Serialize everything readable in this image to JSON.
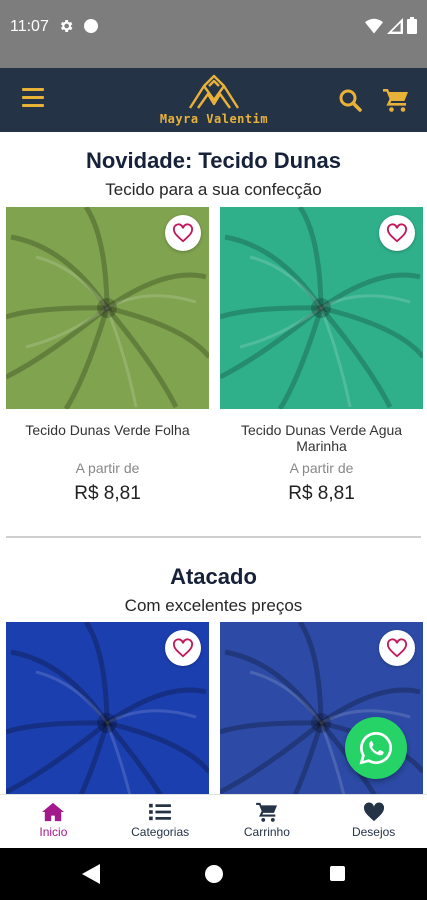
{
  "status_bar": {
    "time": "11:07"
  },
  "header": {
    "logo_text": "Mayra Valentim"
  },
  "colors": {
    "header_bg": "#253347",
    "accent": "#e8b239",
    "active_nav": "#a3198c",
    "whatsapp": "#25d366"
  },
  "sections": [
    {
      "title": "Novidade: Tecido Dunas",
      "subtitle": "Tecido para a sua confecção",
      "products": [
        {
          "name": "Tecido Dunas Verde Folha",
          "price_prefix": "A partir de",
          "price": "R$  8,81",
          "color": "#7fa34e"
        },
        {
          "name": "Tecido Dunas Verde Agua Marinha",
          "price_prefix": "A partir de",
          "price": "R$  8,81",
          "color": "#2fb08b"
        }
      ]
    },
    {
      "title": "Atacado",
      "subtitle": "Com excelentes preços",
      "products": [
        {
          "color": "#1c3fb0"
        },
        {
          "color": "#2d4ba6"
        }
      ]
    }
  ],
  "bottom_nav": [
    {
      "label": "Inicio",
      "icon": "home-icon",
      "active": true
    },
    {
      "label": "Categorias",
      "icon": "list-icon",
      "active": false
    },
    {
      "label": "Carrinho",
      "icon": "cart-icon",
      "active": false
    },
    {
      "label": "Desejos",
      "icon": "heart-icon",
      "active": false
    }
  ]
}
